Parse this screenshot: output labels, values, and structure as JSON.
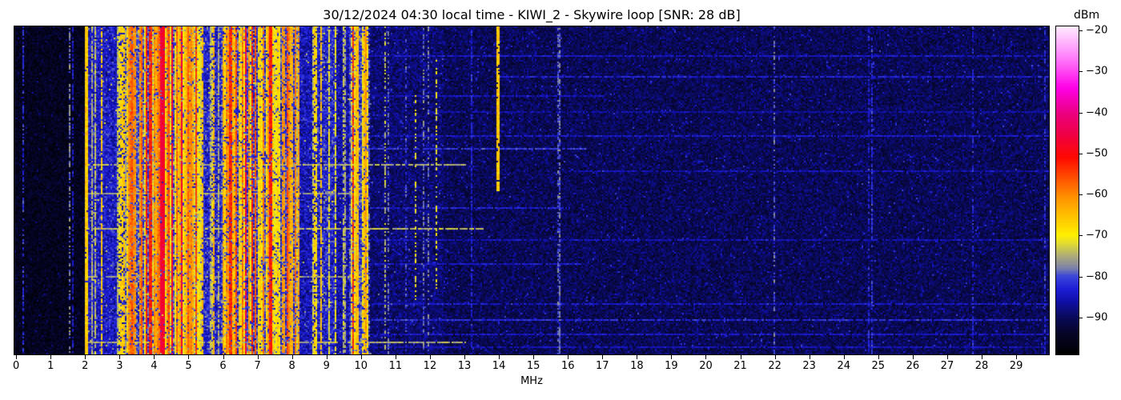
{
  "header": {
    "title": "30/12/2024 04:30 local time - KIWI_2 - Skywire loop [SNR: 28 dB]"
  },
  "axes": {
    "x_label": "MHz",
    "colorbar_label": "dBm"
  },
  "chart_data": {
    "type": "heatmap",
    "subtype": "radio-spectrum-waterfall",
    "title": "30/12/2024 04:30 local time - KIWI_2 - Skywire loop [SNR: 28 dB]",
    "xlabel": "MHz",
    "value_label": "dBm",
    "x_range": [
      -0.05,
      29.95
    ],
    "x_ticks": [
      0,
      1,
      2,
      3,
      4,
      5,
      6,
      7,
      8,
      9,
      10,
      11,
      12,
      13,
      14,
      15,
      16,
      17,
      18,
      19,
      20,
      21,
      22,
      23,
      24,
      25,
      26,
      27,
      28,
      29
    ],
    "value_range_top": -19,
    "value_range_bottom": -99,
    "colorbar_ticks": [
      {
        "v": -20,
        "label": "−20"
      },
      {
        "v": -30,
        "label": "−30"
      },
      {
        "v": -40,
        "label": "−40"
      },
      {
        "v": -50,
        "label": "−50"
      },
      {
        "v": -60,
        "label": "−60"
      },
      {
        "v": -70,
        "label": "−70"
      },
      {
        "v": -80,
        "label": "−80"
      },
      {
        "v": -90,
        "label": "−90"
      }
    ],
    "colormap": [
      {
        "v": -99,
        "c": "#000000"
      },
      {
        "v": -94,
        "c": "#050528"
      },
      {
        "v": -90,
        "c": "#0a0a5a"
      },
      {
        "v": -86,
        "c": "#1010aa"
      },
      {
        "v": -83,
        "c": "#1e1ed7"
      },
      {
        "v": -80,
        "c": "#3c46d7"
      },
      {
        "v": -78,
        "c": "#7d82aa"
      },
      {
        "v": -75,
        "c": "#afac78"
      },
      {
        "v": -72,
        "c": "#e1dc32"
      },
      {
        "v": -70,
        "c": "#fff000"
      },
      {
        "v": -66,
        "c": "#ffc800"
      },
      {
        "v": -61,
        "c": "#ff9600"
      },
      {
        "v": -56,
        "c": "#ff5000"
      },
      {
        "v": -51,
        "c": "#ff0a00"
      },
      {
        "v": -46,
        "c": "#f0003c"
      },
      {
        "v": -40,
        "c": "#eb0082"
      },
      {
        "v": -34,
        "c": "#ff00e6"
      },
      {
        "v": -27,
        "c": "#ff78fa"
      },
      {
        "v": -19,
        "c": "#ffebff"
      }
    ],
    "hot_range": [
      -57,
      -46
    ],
    "bands": [
      {
        "from": -0.05,
        "to": 2.0,
        "base": -95,
        "jitter": 2.5,
        "density": 0.02,
        "lvl": [
          -84,
          -78
        ],
        "hot": 0,
        "drop": 0.4
      },
      {
        "from": 2.0,
        "to": 2.6,
        "base": -84,
        "jitter": 4.0,
        "density": 0.55,
        "lvl": [
          -76,
          -62
        ],
        "hot": 0.07,
        "drop": 0.2
      },
      {
        "from": 2.6,
        "to": 3.2,
        "base": -84,
        "jitter": 4.0,
        "density": 0.4,
        "lvl": [
          -77,
          -64
        ],
        "hot": 0.05,
        "drop": 0.25
      },
      {
        "from": 3.2,
        "to": 5.4,
        "base": -80,
        "jitter": 5.0,
        "density": 0.8,
        "lvl": [
          -73,
          -57
        ],
        "hot": 0.16,
        "drop": 0.12
      },
      {
        "from": 5.4,
        "to": 5.95,
        "base": -83,
        "jitter": 4.5,
        "density": 0.4,
        "lvl": [
          -76,
          -63
        ],
        "hot": 0.05,
        "drop": 0.25
      },
      {
        "from": 5.95,
        "to": 8.2,
        "base": -81,
        "jitter": 5.0,
        "density": 0.7,
        "lvl": [
          -74,
          -58
        ],
        "hot": 0.13,
        "drop": 0.15
      },
      {
        "from": 8.2,
        "to": 8.7,
        "base": -85,
        "jitter": 4.0,
        "density": 0.3,
        "lvl": [
          -77,
          -66
        ],
        "hot": 0.04,
        "drop": 0.3
      },
      {
        "from": 8.7,
        "to": 9.3,
        "base": -83,
        "jitter": 4.5,
        "density": 0.5,
        "lvl": [
          -75,
          -63
        ],
        "hot": 0.07,
        "drop": 0.2
      },
      {
        "from": 9.3,
        "to": 9.65,
        "base": -86,
        "jitter": 3.5,
        "density": 0.25,
        "lvl": [
          -78,
          -69
        ],
        "hot": 0,
        "drop": 0.3
      },
      {
        "from": 9.65,
        "to": 10.2,
        "base": -81,
        "jitter": 4.5,
        "density": 0.6,
        "lvl": [
          -73,
          -61
        ],
        "hot": 0.08,
        "drop": 0.18
      },
      {
        "from": 10.2,
        "to": 12.4,
        "base": -89,
        "jitter": 3.2,
        "density": 0.13,
        "lvl": [
          -80,
          -71
        ],
        "hot": 0,
        "drop": 0.55
      },
      {
        "from": 12.4,
        "to": 29.95,
        "base": -90.5,
        "jitter": 3.0,
        "density": 0.018,
        "lvl": [
          -84,
          -78
        ],
        "hot": 0,
        "drop": 0.5
      }
    ],
    "lines": [
      {
        "f": 1.55,
        "level": -78,
        "top": 0,
        "bottom": 1,
        "drop": 0.45,
        "w": 1
      },
      {
        "f": 2.02,
        "level": -66,
        "top": 0,
        "bottom": 1,
        "drop": 0.03,
        "w": 2
      },
      {
        "f": 3.9,
        "level": -52,
        "top": 0,
        "bottom": 1,
        "drop": 0.1,
        "w": 2
      },
      {
        "f": 4.25,
        "level": -46,
        "top": 0,
        "bottom": 1,
        "drop": 0.04,
        "w": 3
      },
      {
        "f": 6.2,
        "level": -53,
        "top": 0,
        "bottom": 1,
        "drop": 0.12,
        "w": 2
      },
      {
        "f": 7.4,
        "level": -52,
        "top": 0,
        "bottom": 1,
        "drop": 0.1,
        "w": 2
      },
      {
        "f": 9.9,
        "level": -65,
        "top": 0,
        "bottom": 1,
        "drop": 0.05,
        "w": 2
      },
      {
        "f": 10.03,
        "level": -69,
        "top": 0,
        "bottom": 1,
        "drop": 0.15,
        "w": 1
      },
      {
        "f": 11.6,
        "level": -71,
        "top": 0.2,
        "bottom": 0.85,
        "drop": 0.6,
        "w": 1
      },
      {
        "f": 12.2,
        "level": -71,
        "top": 0.1,
        "bottom": 0.8,
        "drop": 0.55,
        "w": 1
      },
      {
        "f": 13.2,
        "level": -83,
        "top": 0,
        "bottom": 1,
        "drop": 0.35,
        "w": 1
      },
      {
        "f": 13.98,
        "level": -66,
        "top": 0,
        "bottom": 0.5,
        "drop": 0.08,
        "w": 2
      },
      {
        "f": 15.75,
        "level": -79,
        "top": 0,
        "bottom": 1,
        "drop": 0.25,
        "w": 1
      }
    ],
    "streaks": [
      {
        "y": 0.09,
        "from": 10,
        "to": 30,
        "level": -84
      },
      {
        "y": 0.151,
        "from": 14,
        "to": 30,
        "level": -83
      },
      {
        "y": 0.212,
        "from": 10,
        "to": 17,
        "level": -85
      },
      {
        "y": 0.26,
        "from": 12,
        "to": 30,
        "level": -86
      },
      {
        "y": 0.334,
        "from": 10,
        "to": 30,
        "level": -84
      },
      {
        "y": 0.371,
        "from": 10,
        "to": 16.5,
        "level": -81
      },
      {
        "y": 0.42,
        "from": 2.1,
        "to": 13,
        "level": -75
      },
      {
        "y": 0.437,
        "from": 16,
        "to": 30,
        "level": -85
      },
      {
        "y": 0.505,
        "from": 2.1,
        "to": 10,
        "level": -76
      },
      {
        "y": 0.549,
        "from": 10,
        "to": 16,
        "level": -83
      },
      {
        "y": 0.615,
        "from": 2.1,
        "to": 13.5,
        "level": -74
      },
      {
        "y": 0.651,
        "from": 10,
        "to": 30,
        "level": -85
      },
      {
        "y": 0.724,
        "from": 10,
        "to": 16.5,
        "level": -84
      },
      {
        "y": 0.761,
        "from": 2.1,
        "to": 10,
        "level": -76
      },
      {
        "y": 0.846,
        "from": 10,
        "to": 30,
        "level": -84
      },
      {
        "y": 0.895,
        "from": 9,
        "to": 30,
        "level": -82
      },
      {
        "y": 0.937,
        "from": 10,
        "to": 30,
        "level": -84
      },
      {
        "y": 0.963,
        "from": 2.1,
        "to": 13,
        "level": -75
      },
      {
        "y": 0.976,
        "from": 10,
        "to": 30,
        "level": -85
      }
    ]
  }
}
